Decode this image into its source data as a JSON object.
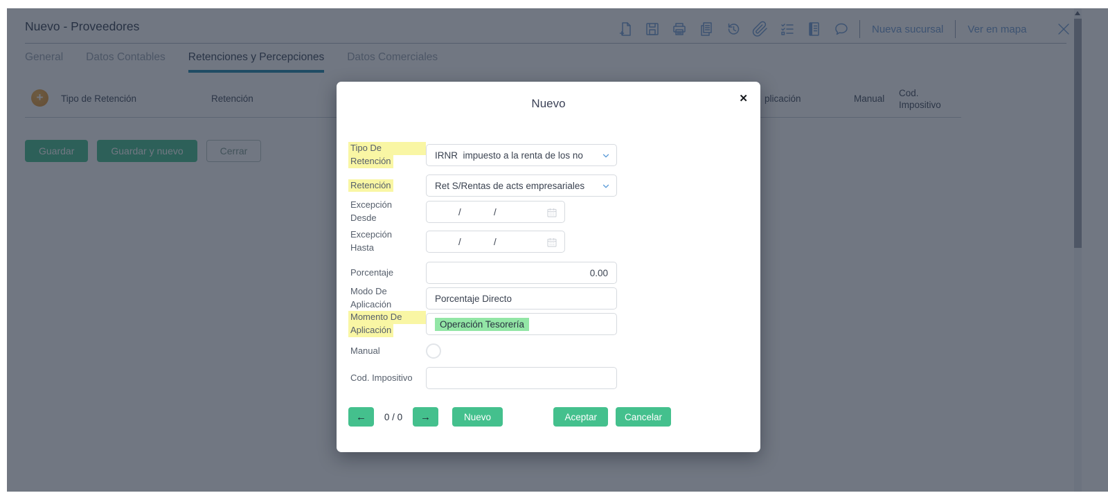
{
  "window": {
    "title": "Nuevo - Proveedores"
  },
  "toolbar": {
    "icons": [
      "new-document",
      "save",
      "print",
      "copy",
      "history",
      "attachment",
      "checklist",
      "journal",
      "comment"
    ],
    "links": {
      "new_branch": "Nueva sucursal",
      "view_map": "Ver en mapa"
    }
  },
  "tabs": [
    {
      "label": "General",
      "active": false
    },
    {
      "label": "Datos Contables",
      "active": false
    },
    {
      "label": "Retenciones y Percepciones",
      "active": true
    },
    {
      "label": "Datos Comerciales",
      "active": false
    }
  ],
  "table": {
    "columns": [
      "Tipo de Retención",
      "Retención",
      "plicación",
      "Manual",
      "Cod. Impositivo"
    ]
  },
  "actions": {
    "save": "Guardar",
    "save_new": "Guardar y nuevo",
    "close": "Cerrar"
  },
  "modal": {
    "title": "Nuevo",
    "close_glyph": "✕",
    "date_separator": "/",
    "fields": [
      {
        "label1": "Tipo De",
        "label2": "Retención",
        "value": "IRNR  impuesto a la renta de los no",
        "highlighted": true
      },
      {
        "label1": "Retención",
        "value": "Ret S/Rentas de acts empresariales",
        "highlighted": true
      },
      {
        "label1": "Excepción",
        "label2": "Desde",
        "value": ""
      },
      {
        "label1": "Excepción",
        "label2": "Hasta",
        "value": ""
      },
      {
        "label1": "Porcentaje",
        "value": "0.00"
      },
      {
        "label1": "Modo De",
        "label2": "Aplicación",
        "value": "Porcentaje Directo"
      },
      {
        "label1": "Momento De",
        "label2": "Aplicación",
        "value": "Operación Tesorería",
        "highlighted": true
      },
      {
        "label1": "Manual",
        "value": ""
      },
      {
        "label1": "Cod. Impositivo",
        "value": ""
      }
    ],
    "footer": {
      "prev": "←",
      "counter": "0 / 0",
      "next": "→",
      "new": "Nuevo",
      "accept": "Aceptar",
      "cancel": "Cancelar"
    }
  },
  "colors": {
    "accent_green": "#44c08d",
    "highlight_yellow": "#f9f6a4",
    "highlight_green": "#93e6a6",
    "tab_underline": "#1e87ab",
    "icon_link_blue": "#6f9bd2",
    "plus_orange": "#dd8f2d",
    "overlay": "rgba(33,42,60,0.64)"
  }
}
